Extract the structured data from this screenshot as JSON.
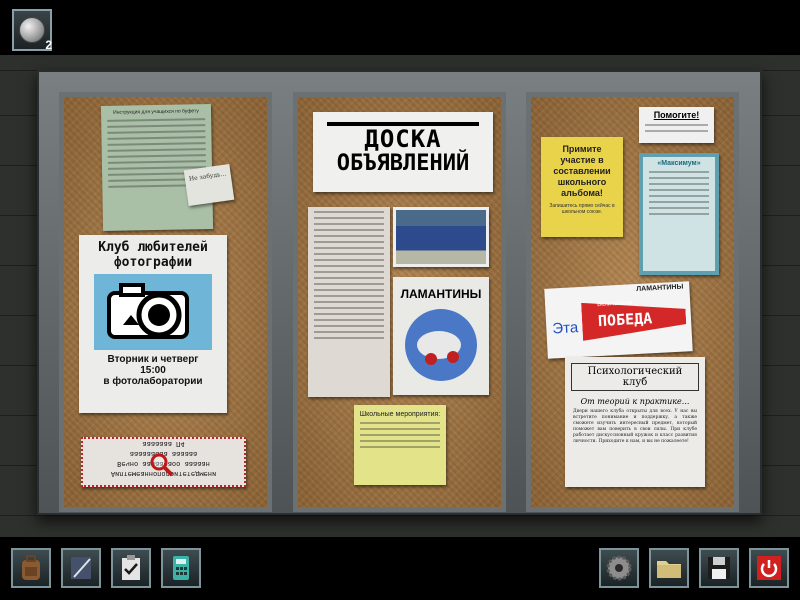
{
  "inventory": {
    "count": "2",
    "item_icon": "quarter-coin-icon"
  },
  "board": {
    "left": {
      "rules_title": "Инструкция для учащихся по буфету",
      "note": "Не забудь…",
      "photo_club": {
        "title_line1": "Клуб любителей",
        "title_line2": "фотографии",
        "when_line1": "Вторник и четверг",
        "time": "15:00",
        "where": "в фотолаборатории"
      },
      "mirror_note": {
        "line1": "Аилтемеанноподоитетедмени",
        "line2": "Вечно аааааоаоо ааааан",
        "line3": "ааааааааа аааааа",
        "line4": "ааааааа П4"
      }
    },
    "center": {
      "title_line1": "ДОСКА",
      "title_line2": "ОБЪЯВЛЕНИЙ",
      "manatees": "ЛАМАНТИНЫ",
      "school_events": "Школьные мероприятия:"
    },
    "right": {
      "yearbook": {
        "line1": "Примите",
        "line2": "участие в",
        "line3": "составлении",
        "line4": "школьного",
        "line5": "альбома!",
        "small": "Запишитесь прямо сейчас в школьном союзе."
      },
      "help": "Помогите!",
      "maxim": "«Максимум»",
      "pennant": {
        "top": "ЛАМАНТИНЫ",
        "left": "Эта",
        "word": "ПОБЕДА",
        "small": "Величайшая"
      },
      "psych": {
        "title": "Психологический клуб",
        "subtitle": "От теорий к практике...",
        "body": "Двери нашего клуба открыты для всех. У нас вы встретите понимание и поддержку, а также сможете изучить интересный предмет, который поможет вам поверить в свои силы. При клубе работает дискуссионный кружок и класс развития личности. Приходите к нам, и вы не пожалеете!"
      }
    }
  },
  "toolbar_left": [
    {
      "name": "backpack-button",
      "icon": "backpack-icon"
    },
    {
      "name": "notebook-button",
      "icon": "notebook-icon"
    },
    {
      "name": "task-list-button",
      "icon": "checklist-icon"
    },
    {
      "name": "cellphone-button",
      "icon": "calculator-icon"
    }
  ],
  "toolbar_right": [
    {
      "name": "settings-button",
      "icon": "gear-icon"
    },
    {
      "name": "files-button",
      "icon": "folder-icon"
    },
    {
      "name": "save-button",
      "icon": "floppy-icon"
    },
    {
      "name": "quit-button",
      "icon": "power-icon"
    }
  ],
  "colors": {
    "accent": "#6c8a92",
    "power": "#d02020",
    "bulletin_yellow": "#e9d34a"
  }
}
